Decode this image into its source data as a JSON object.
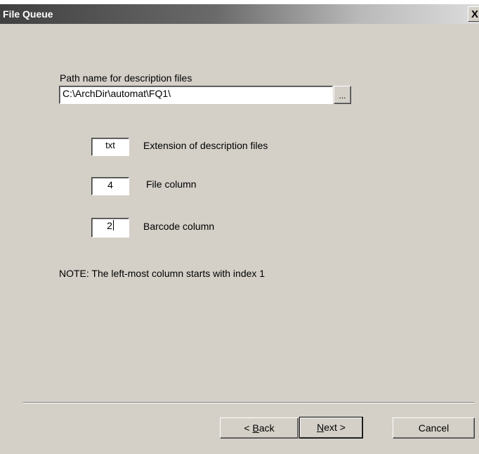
{
  "window": {
    "title": "File Queue",
    "close_glyph": "X"
  },
  "form": {
    "path_label": "Path name for description files",
    "path_value": "C:\\ArchDir\\automat\\FQ1\\",
    "browse_label": "...",
    "extension_value": "txt",
    "extension_label": "Extension of description files",
    "file_column_value": "4",
    "file_column_label": "File column",
    "barcode_column_value": "2",
    "barcode_column_label": "Barcode column",
    "note": "NOTE: The left-most column starts with index 1"
  },
  "buttons": {
    "back_prefix": "< ",
    "back_mnemonic": "B",
    "back_rest": "ack",
    "next_mnemonic": "N",
    "next_rest": "ext >",
    "cancel": "Cancel"
  }
}
